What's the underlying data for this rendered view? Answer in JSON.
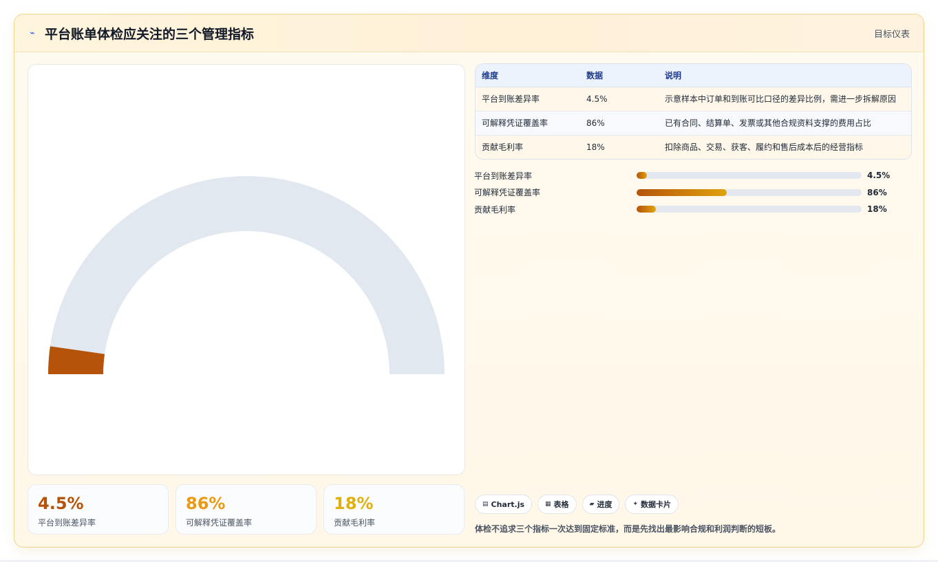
{
  "header": {
    "icon": "pulse-icon",
    "title": "平台账单体检应关注的三个管理指标",
    "tag": "目标仪表"
  },
  "colors": {
    "metric1": "#b45309",
    "metric2": "#ea9a12",
    "metric3": "#e0b10e",
    "gauge_track": "#e2e8f0",
    "gauge_fill": "#b5530b"
  },
  "gauge": {
    "value_percent": 4.5,
    "max_percent": 100
  },
  "stats": [
    {
      "value": "4.5%",
      "label": "平台到账差异率"
    },
    {
      "value": "86%",
      "label": "可解释凭证覆盖率"
    },
    {
      "value": "18%",
      "label": "贡献毛利率"
    }
  ],
  "table": {
    "headers": [
      "维度",
      "数据",
      "说明"
    ],
    "rows": [
      [
        "平台到账差异率",
        "4.5%",
        "示意样本中订单和到账可比口径的差异比例，需进一步拆解原因"
      ],
      [
        "可解释凭证覆盖率",
        "86%",
        "已有合同、结算单、发票或其他合规资料支撑的费用占比"
      ],
      [
        "贡献毛利率",
        "18%",
        "扣除商品、交易、获客、履约和售后成本后的经营指标"
      ]
    ]
  },
  "bars": [
    {
      "label": "平台到账差异率",
      "value": "4.5%",
      "fraction": 0.045
    },
    {
      "label": "可解释凭证覆盖率",
      "value": "86%",
      "fraction": 0.4
    },
    {
      "label": "贡献毛利率",
      "value": "18%",
      "fraction": 0.085
    }
  ],
  "chips": [
    {
      "icon": "chart-icon",
      "glyph": "▤",
      "label": "Chart.js"
    },
    {
      "icon": "table-icon",
      "glyph": "▦",
      "label": "表格"
    },
    {
      "icon": "progress-icon",
      "glyph": "▰",
      "label": "进度"
    },
    {
      "icon": "sparkle-icon",
      "glyph": "✦",
      "label": "数据卡片"
    }
  ],
  "note": "体检不追求三个指标一次达到固定标准，而是先找出最影响合规和利润判断的短板。"
}
